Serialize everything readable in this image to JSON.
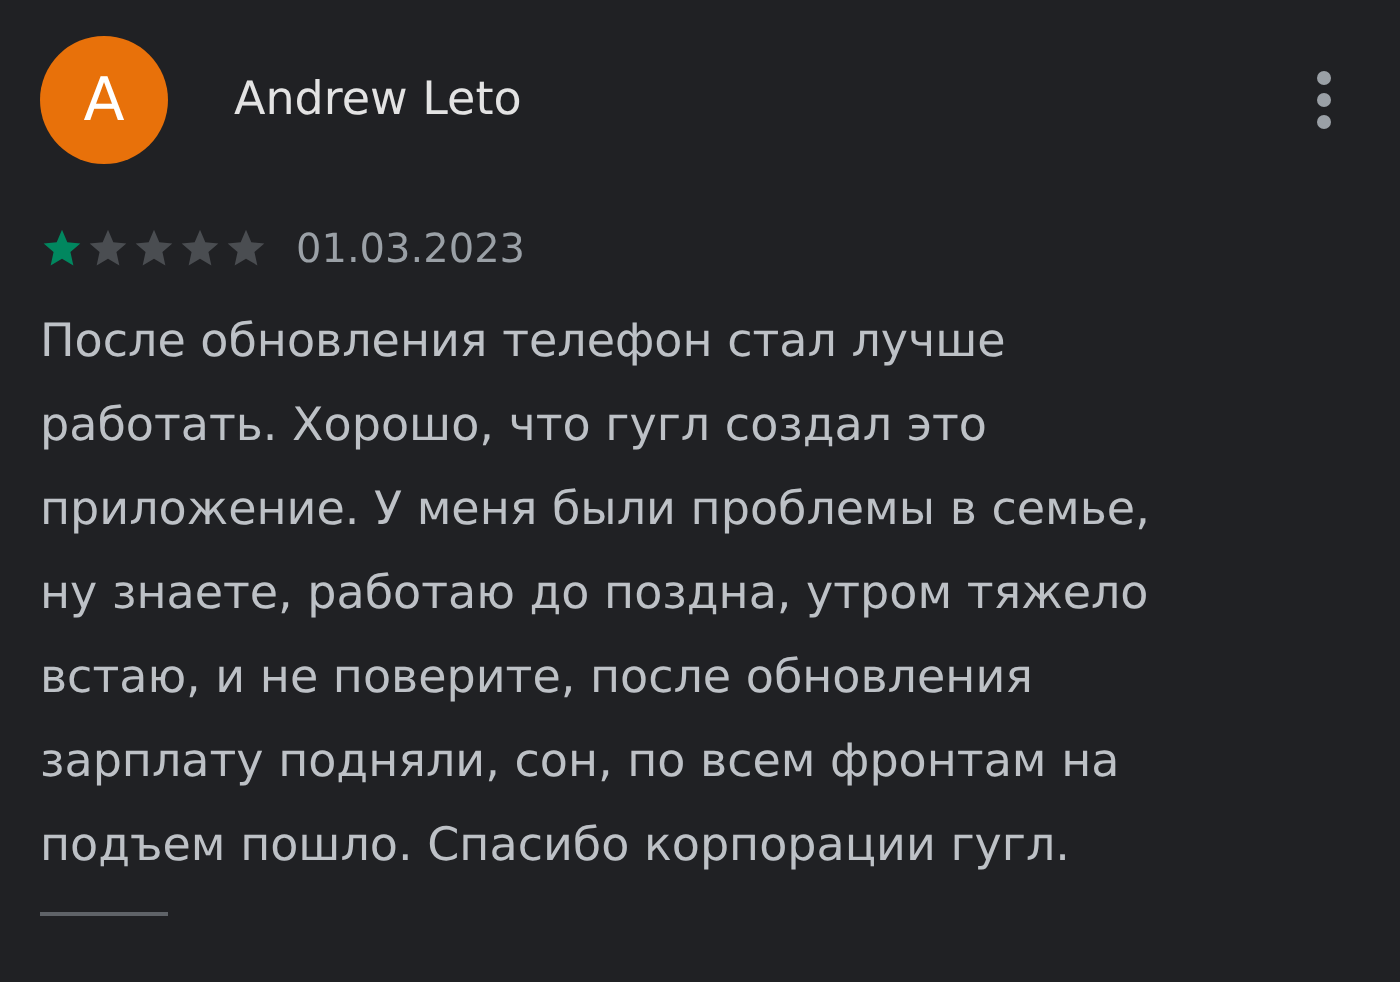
{
  "review": {
    "avatar_letter": "A",
    "author": "Andrew Leto",
    "stars": 1,
    "date": "01.03.2023",
    "text": "После обновления телефон стал лучше работать. Хорошо, что гугл создал это приложение. У меня были проблемы в семье, ну знаете, работаю до поздна, утром тяжело встаю, и не поверите, после обновления зарплату подняли, сон, по всем фронтам на подъем пошло. Спасибо корпорации гугл."
  }
}
